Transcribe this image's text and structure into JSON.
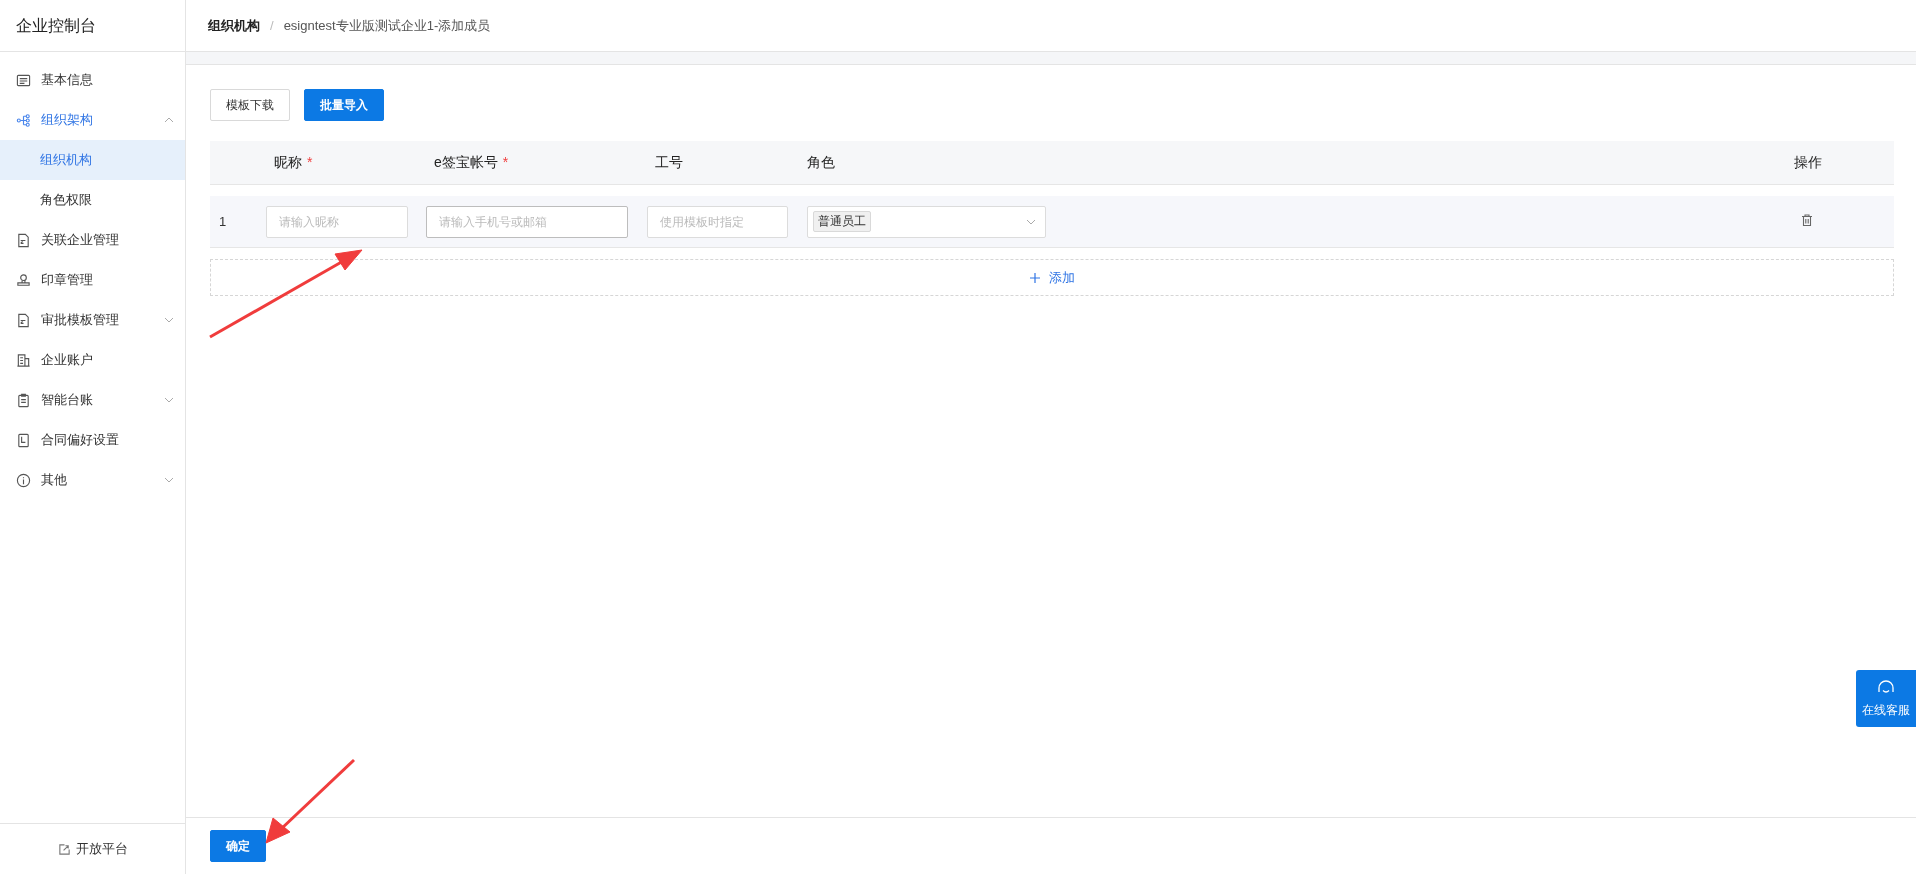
{
  "sidebar": {
    "title": "企业控制台",
    "items": [
      {
        "kind": "link",
        "label": "基本信息"
      },
      {
        "kind": "group",
        "label": "组织架构",
        "expanded": true,
        "children": [
          {
            "label": "组织机构",
            "selected": true
          },
          {
            "label": "角色权限",
            "selected": false
          }
        ]
      },
      {
        "kind": "link",
        "label": "关联企业管理"
      },
      {
        "kind": "link",
        "label": "印章管理"
      },
      {
        "kind": "group",
        "label": "审批模板管理",
        "expanded": false
      },
      {
        "kind": "link",
        "label": "企业账户"
      },
      {
        "kind": "group",
        "label": "智能台账",
        "expanded": false
      },
      {
        "kind": "link",
        "label": "合同偏好设置"
      },
      {
        "kind": "group",
        "label": "其他",
        "expanded": false
      }
    ],
    "footer": "开放平台"
  },
  "breadcrumb": [
    "组织机构",
    "esigntest专业版测试企业1-添加成员"
  ],
  "breadcrumb_separator": "/",
  "toolbar": [
    {
      "label": "模板下载",
      "primary": false
    },
    {
      "label": "批量导入",
      "primary": true
    }
  ],
  "table": {
    "columns": [
      {
        "label": "昵称",
        "required_mark": "*"
      },
      {
        "label": "e签宝帐号",
        "required_mark": "*"
      },
      {
        "label": "工号"
      },
      {
        "label": "角色"
      },
      {
        "label": "操作"
      }
    ],
    "rows": [
      {
        "index": "1",
        "nickname_placeholder": "请输入昵称",
        "account_placeholder": "请输入手机号或邮箱",
        "employee_no_placeholder": "使用模板时指定",
        "roles": [
          "普通员工"
        ]
      }
    ],
    "add_label": "添加"
  },
  "confirm_button": "确定",
  "support_button": "在线客服"
}
